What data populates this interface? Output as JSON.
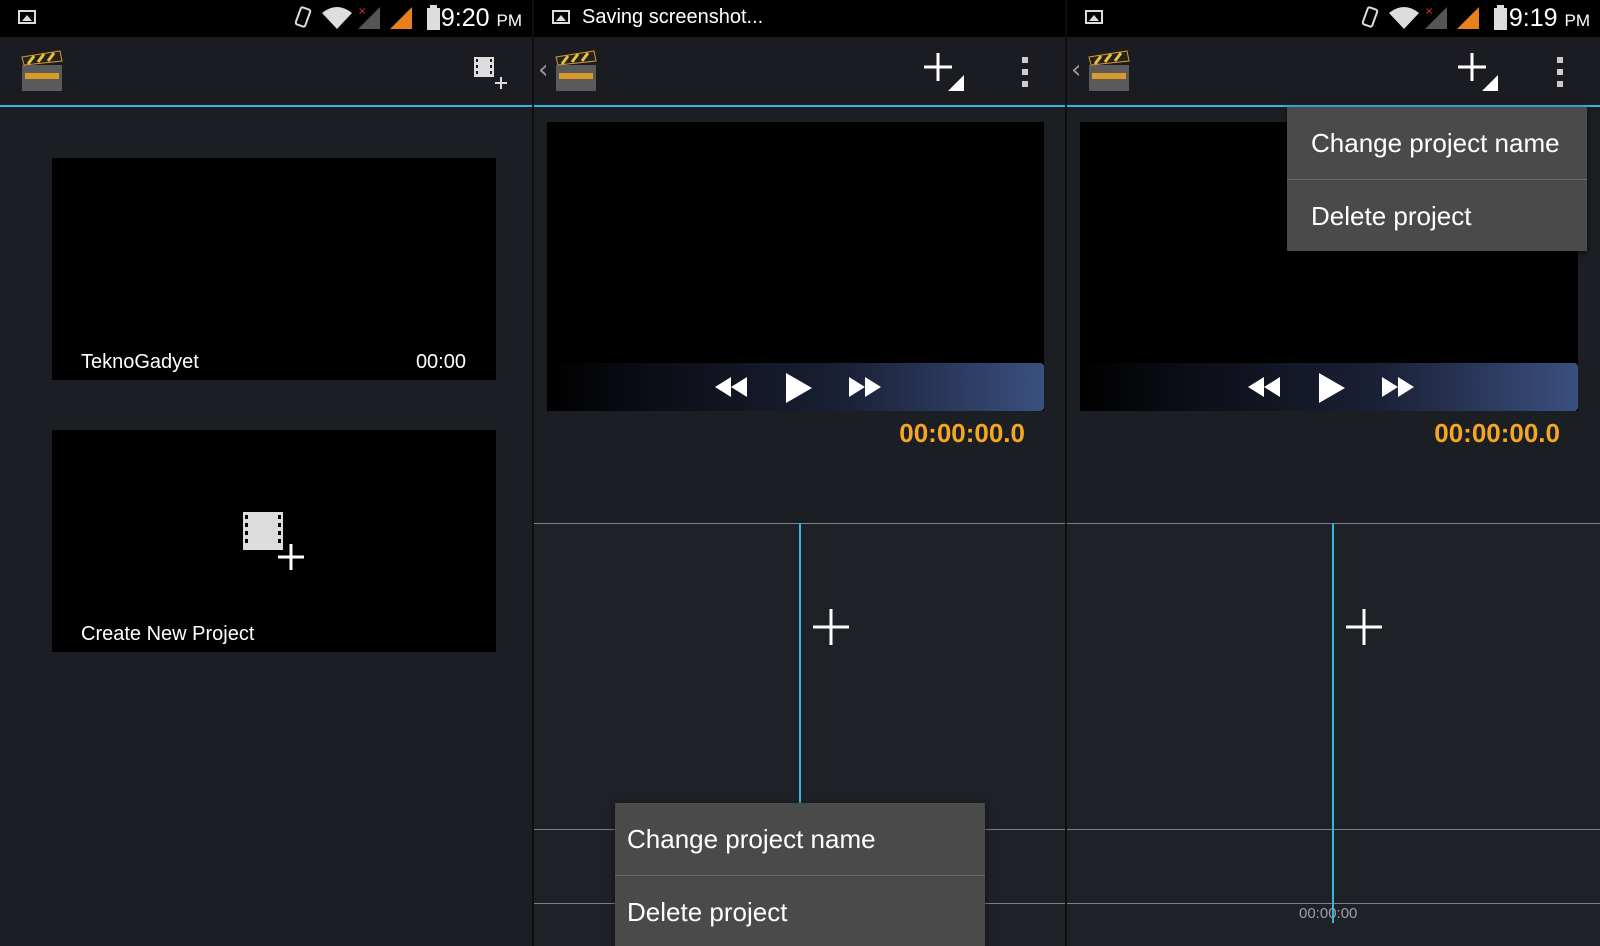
{
  "panel1": {
    "status": {
      "time": "9:20",
      "ampm": "PM"
    },
    "projects": [
      {
        "name": "TeknoGadyet",
        "duration": "00:00"
      }
    ],
    "new_project_label": "Create New Project"
  },
  "panel2": {
    "status": {
      "notification": "Saving screenshot..."
    },
    "player": {
      "timecode": "00:00:00.0"
    },
    "menu": {
      "items": [
        "Change project name",
        "Delete project"
      ]
    }
  },
  "panel3": {
    "status": {
      "time": "9:19",
      "ampm": "PM"
    },
    "player": {
      "timecode": "00:00:00.0"
    },
    "timeline": {
      "time_label": "00:00:00"
    },
    "menu": {
      "items": [
        "Change project name",
        "Delete project"
      ]
    }
  },
  "colors": {
    "accent": "#33b5e5",
    "timecode": "#f5a623",
    "menu_bg": "#4a4a4a"
  },
  "icons": [
    "picture-icon",
    "vibrate-icon",
    "wifi-icon",
    "signal-icon",
    "battery-icon",
    "app-logo-icon",
    "add-media-icon",
    "overflow-menu-icon",
    "rewind-icon",
    "play-icon",
    "fast-forward-icon",
    "add-clip-icon",
    "back-chevron-icon"
  ]
}
